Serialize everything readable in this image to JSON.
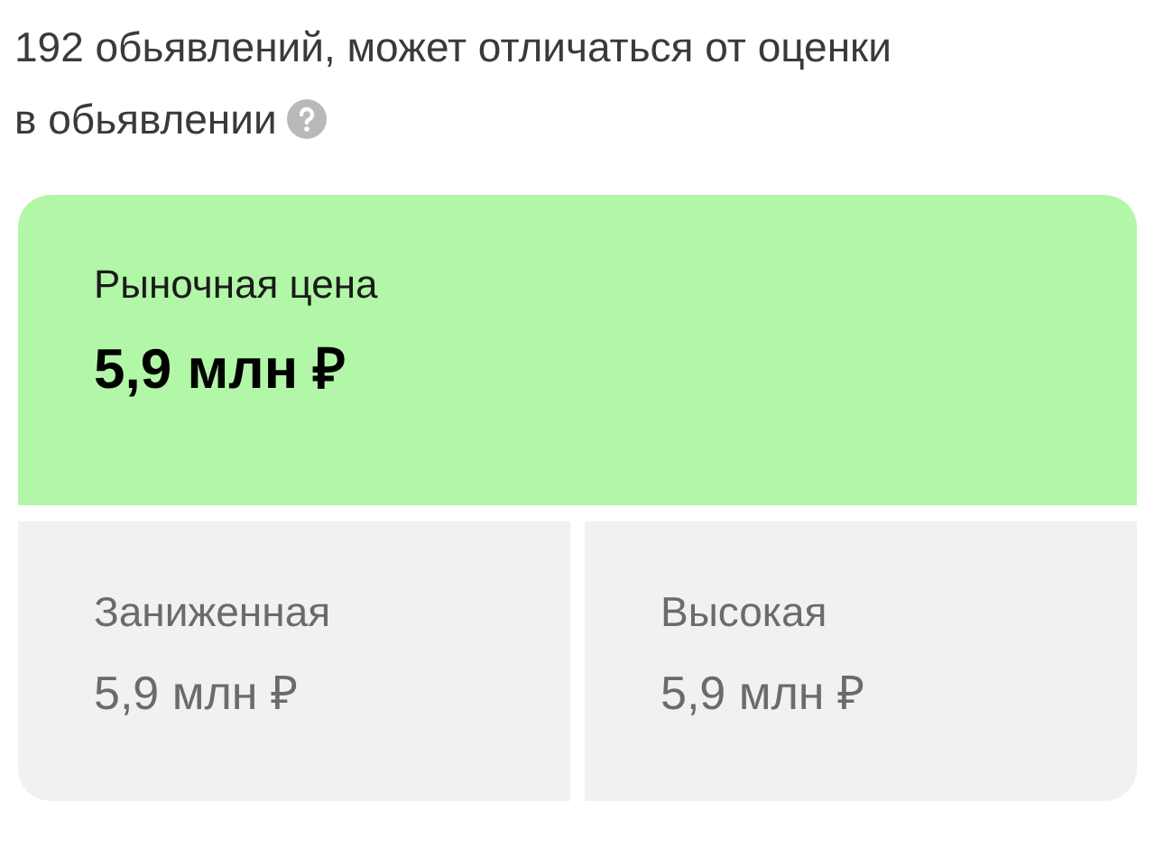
{
  "summary": {
    "lines": [
      "192 обьявлений, может отличаться от оценки",
      "в обьявлении"
    ]
  },
  "market": {
    "label": "Рыночная цена",
    "value": "5,9 млн ₽"
  },
  "ranges": [
    {
      "label": "Заниженная",
      "value": "5,9 млн ₽"
    },
    {
      "label": "Высокая",
      "value": "5,9 млн ₽"
    }
  ]
}
